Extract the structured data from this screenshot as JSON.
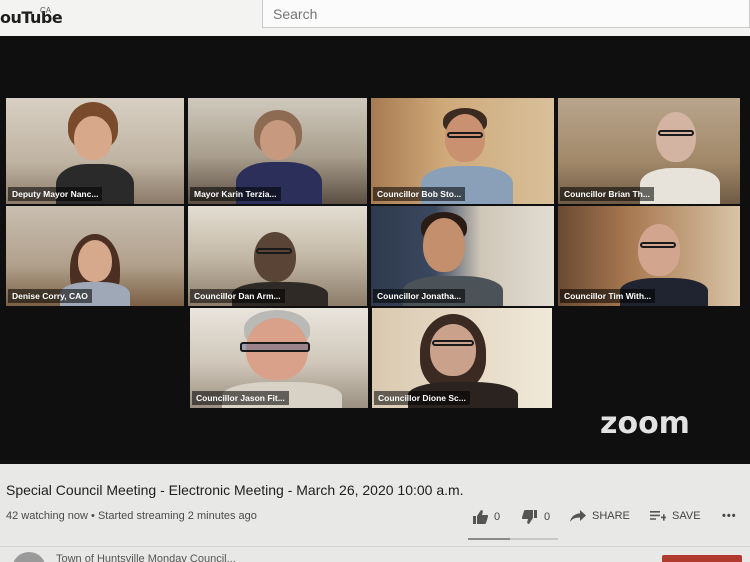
{
  "header": {
    "logo_text": "ouTube",
    "region": "CA",
    "search_placeholder": "Search"
  },
  "meeting": {
    "participants": [
      {
        "name": "Deputy Mayor Nanc..."
      },
      {
        "name": "Mayor Karin Terzia..."
      },
      {
        "name": "Councillor Bob Sto..."
      },
      {
        "name": "Councillor Brian Th..."
      },
      {
        "name": "Denise Corry, CAO"
      },
      {
        "name": "Councillor Dan Arm..."
      },
      {
        "name": "Councillor Jonatha..."
      },
      {
        "name": "Councillor Tim With..."
      },
      {
        "name": "Councillor Jason Fit..."
      },
      {
        "name": "Councillor Dione Sc..."
      }
    ],
    "app_logo": "zoom"
  },
  "video_info": {
    "title": "Special Council Meeting - Electronic Meeting - March 26, 2020 10:00 a.m.",
    "watching": "42 watching now",
    "started": "Started streaming 2 minutes ago",
    "likes": "0",
    "dislikes": "0",
    "share_label": "SHARE",
    "save_label": "SAVE",
    "channel": "Town of Huntsville Monday Council..."
  },
  "colors": {
    "active_speaker": "#9bd137",
    "subscribe": "#b03a2e"
  }
}
